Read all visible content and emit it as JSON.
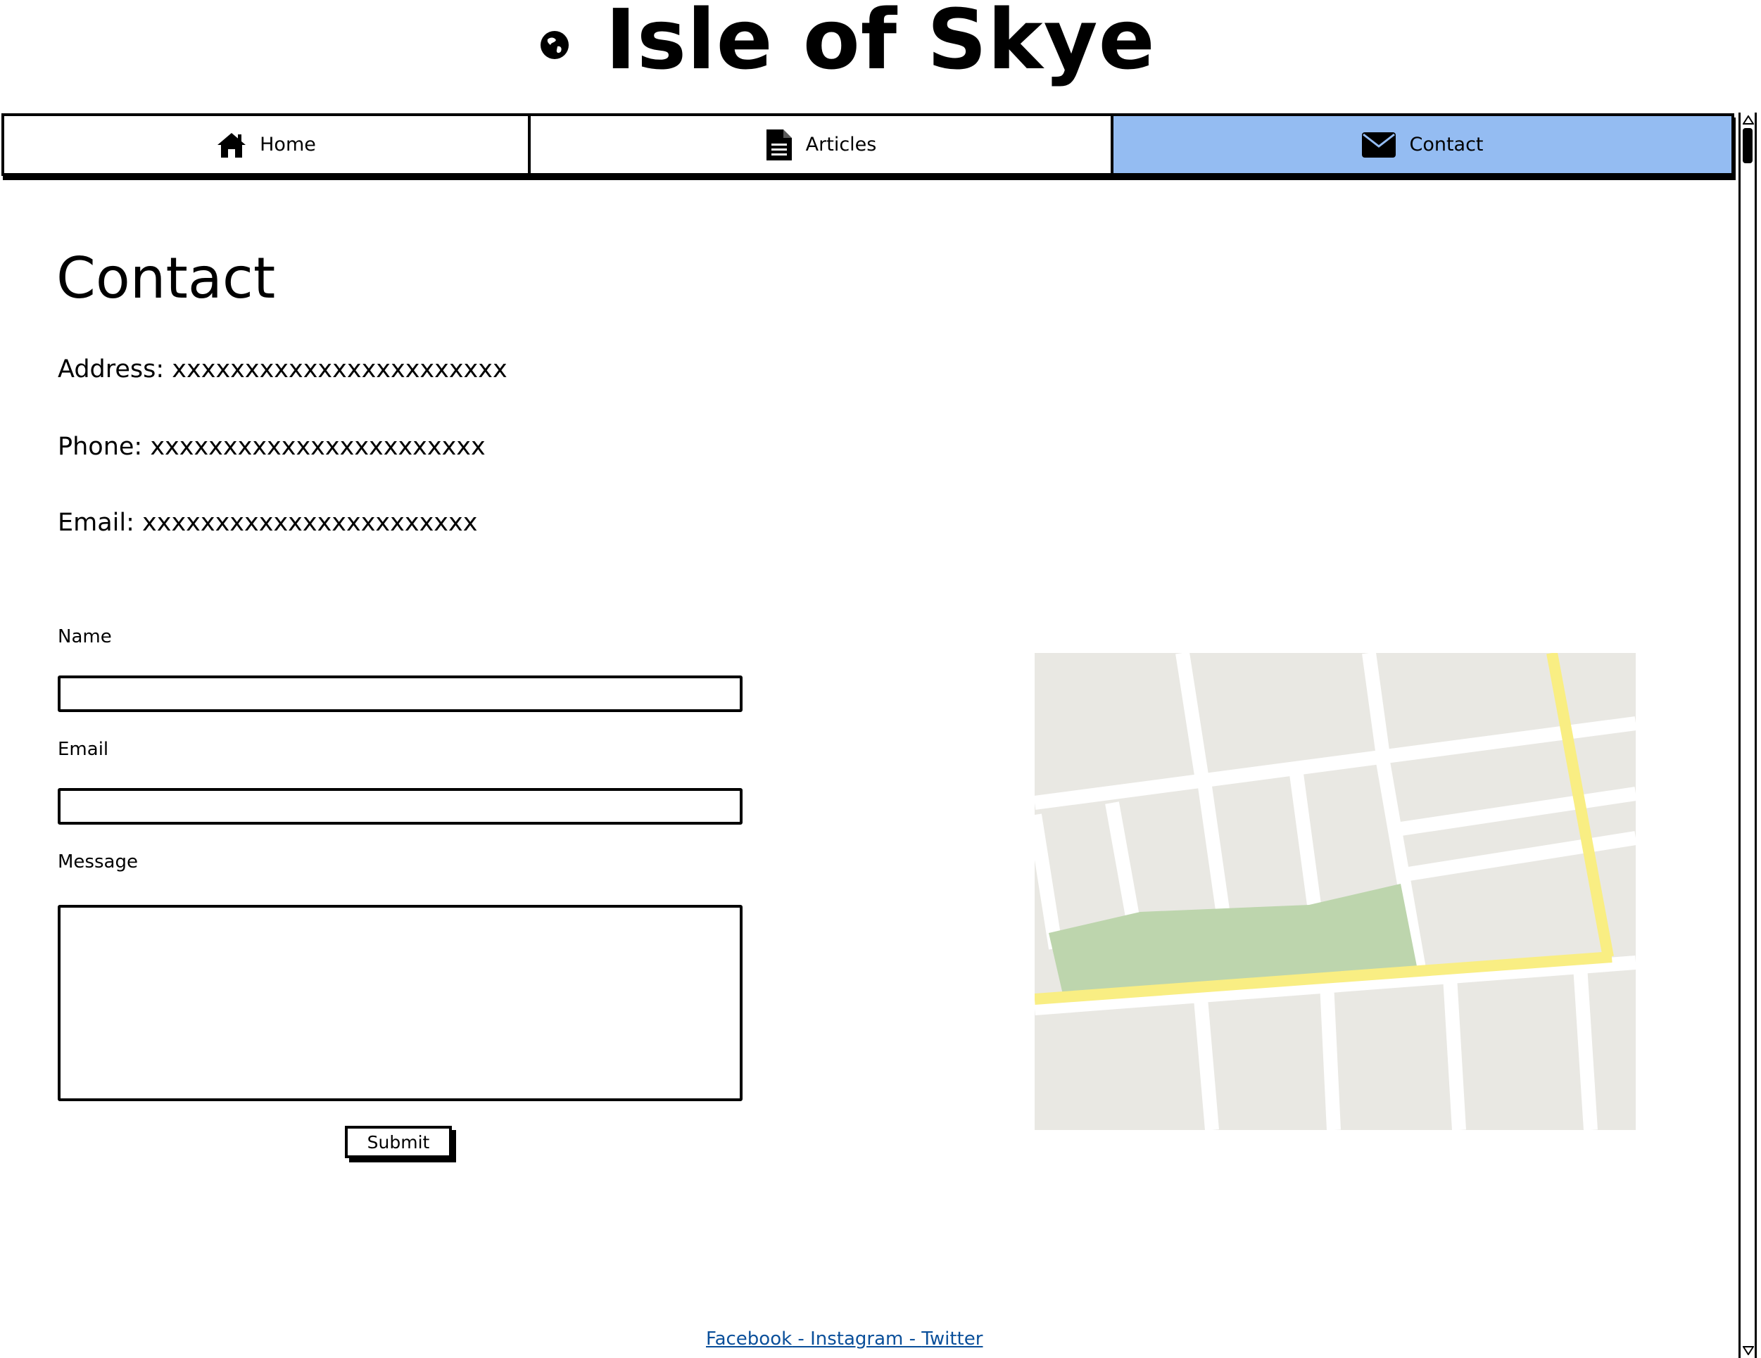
{
  "header": {
    "title": "Isle of Skye",
    "icon": "globe-icon"
  },
  "nav": {
    "tabs": [
      {
        "label": "Home",
        "icon": "home-icon",
        "active": false
      },
      {
        "label": "Articles",
        "icon": "document-icon",
        "active": false
      },
      {
        "label": "Contact",
        "icon": "envelope-icon",
        "active": true
      }
    ],
    "active_color": "#94bcf2"
  },
  "main": {
    "heading": "Contact",
    "address": "Address: xxxxxxxxxxxxxxxxxxxxxxx",
    "phone": "Phone: xxxxxxxxxxxxxxxxxxxxxxx",
    "email": "Email: xxxxxxxxxxxxxxxxxxxxxxx"
  },
  "form": {
    "name_label": "Name",
    "name_value": "",
    "email_label": "Email",
    "email_value": "",
    "message_label": "Message",
    "message_value": "",
    "submit_label": "Submit"
  },
  "footer": {
    "facebook": "Facebook",
    "instagram": "Instagram",
    "twitter": "Twitter",
    "separator": " - ",
    "link_color": "#0a4f9a"
  }
}
